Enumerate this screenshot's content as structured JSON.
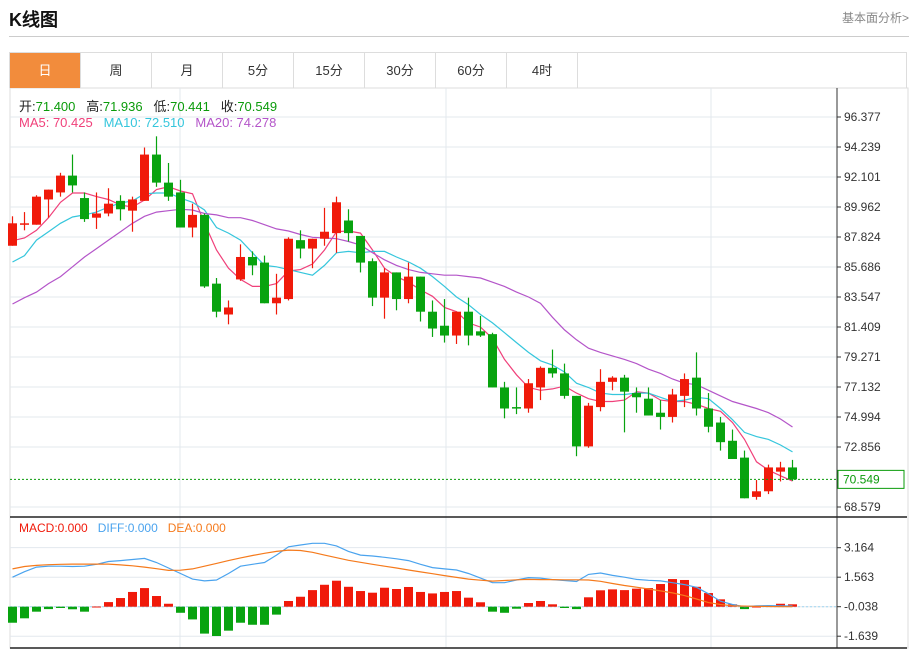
{
  "header": {
    "title": "K线图",
    "link": "基本面分析>"
  },
  "tabs": [
    "日",
    "周",
    "月",
    "5分",
    "15分",
    "30分",
    "60分",
    "4时"
  ],
  "ohlc": {
    "open_label": "开:",
    "open": "71.400",
    "high_label": "高:",
    "high": "71.936",
    "low_label": "低:",
    "low": "70.441",
    "close_label": "收:",
    "close": "70.549"
  },
  "ma_legend": {
    "ma5": "MA5: 70.425",
    "ma10": "MA10: 72.510",
    "ma20": "MA20: 74.278"
  },
  "macd_legend": {
    "macd": "MACD:0.000",
    "diff": "DIFF:0.000",
    "dea": "DEA:0.000"
  },
  "colors": {
    "up": "#f01a0a",
    "down": "#08a30f",
    "ma5": "#f0407a",
    "ma10": "#35c6dc",
    "ma20": "#b455c9",
    "diff": "#4aa3ee",
    "dea": "#f57a1c",
    "accent": "#f28c3c"
  },
  "chart_data": [
    {
      "type": "candlestick",
      "price_ticks": [
        "96.377",
        "94.239",
        "92.101",
        "89.962",
        "87.824",
        "85.686",
        "83.547",
        "81.409",
        "79.271",
        "77.132",
        "74.994",
        "72.856",
        "68.579"
      ],
      "price_tick_values": [
        96.377,
        94.239,
        92.101,
        89.962,
        87.824,
        85.686,
        83.547,
        81.409,
        79.271,
        77.132,
        74.994,
        72.856,
        68.579
      ],
      "last_price": "70.549",
      "last_price_value": 70.549,
      "candles_ohlc": [
        [
          87.2,
          89.3,
          87.2,
          88.8
        ],
        [
          88.7,
          89.6,
          88.3,
          88.8
        ],
        [
          88.7,
          90.8,
          88.7,
          90.7
        ],
        [
          90.5,
          91.2,
          89.2,
          91.2
        ],
        [
          91.0,
          92.4,
          90.7,
          92.2
        ],
        [
          92.2,
          93.7,
          91.0,
          91.5
        ],
        [
          90.6,
          91.0,
          88.9,
          89.1
        ],
        [
          89.2,
          91.0,
          88.4,
          89.5
        ],
        [
          89.5,
          91.3,
          89.3,
          90.2
        ],
        [
          90.4,
          90.8,
          89.0,
          89.8
        ],
        [
          89.7,
          90.7,
          88.2,
          90.5
        ],
        [
          90.4,
          94.2,
          90.4,
          93.7
        ],
        [
          93.7,
          95.0,
          91.4,
          91.7
        ],
        [
          91.7,
          93.1,
          90.4,
          90.7
        ],
        [
          91.0,
          91.9,
          88.5,
          88.5
        ],
        [
          88.5,
          90.2,
          87.8,
          89.4
        ],
        [
          89.4,
          89.5,
          84.2,
          84.3
        ],
        [
          84.5,
          84.9,
          82.1,
          82.5
        ],
        [
          82.3,
          83.3,
          81.6,
          82.8
        ],
        [
          84.8,
          87.3,
          84.7,
          86.4
        ],
        [
          86.4,
          86.8,
          85.1,
          85.8
        ],
        [
          86.0,
          86.5,
          83.1,
          83.1
        ],
        [
          83.1,
          85.2,
          82.3,
          83.5
        ],
        [
          83.4,
          87.8,
          83.3,
          87.7
        ],
        [
          87.6,
          88.3,
          86.3,
          87.0
        ],
        [
          87.0,
          87.7,
          85.6,
          87.7
        ],
        [
          87.7,
          89.9,
          87.2,
          88.2
        ],
        [
          88.1,
          90.7,
          86.7,
          90.3
        ],
        [
          89.0,
          89.8,
          87.5,
          88.1
        ],
        [
          87.9,
          87.9,
          85.3,
          86.0
        ],
        [
          86.1,
          86.3,
          82.9,
          83.5
        ],
        [
          83.5,
          85.6,
          82.0,
          85.3
        ],
        [
          85.3,
          85.3,
          82.6,
          83.4
        ],
        [
          83.4,
          86.0,
          83.1,
          85.0
        ],
        [
          85.0,
          85.0,
          81.8,
          82.5
        ],
        [
          82.5,
          83.3,
          80.7,
          81.3
        ],
        [
          81.5,
          83.4,
          80.3,
          80.8
        ],
        [
          80.8,
          82.5,
          80.2,
          82.5
        ],
        [
          82.5,
          83.5,
          80.1,
          80.8
        ],
        [
          81.1,
          82.2,
          80.7,
          80.8
        ],
        [
          80.9,
          81.0,
          77.1,
          77.1
        ],
        [
          77.1,
          77.5,
          74.9,
          75.6
        ],
        [
          75.7,
          77.1,
          75.2,
          75.6
        ],
        [
          75.6,
          77.7,
          75.3,
          77.4
        ],
        [
          77.1,
          78.6,
          76.2,
          78.5
        ],
        [
          78.5,
          79.8,
          77.8,
          78.1
        ],
        [
          78.1,
          78.8,
          76.3,
          76.5
        ],
        [
          76.5,
          76.5,
          72.2,
          72.9
        ],
        [
          72.9,
          76.0,
          72.8,
          75.8
        ],
        [
          75.7,
          78.4,
          75.4,
          77.5
        ],
        [
          77.5,
          77.9,
          76.9,
          77.8
        ],
        [
          77.8,
          78.0,
          73.9,
          76.8
        ],
        [
          76.7,
          77.1,
          75.3,
          76.4
        ],
        [
          76.3,
          77.1,
          75.1,
          75.1
        ],
        [
          75.3,
          76.2,
          74.1,
          75.0
        ],
        [
          75.0,
          77.0,
          74.6,
          76.6
        ],
        [
          76.5,
          78.1,
          75.7,
          77.7
        ],
        [
          77.8,
          79.6,
          75.1,
          75.6
        ],
        [
          75.6,
          76.7,
          73.9,
          74.3
        ],
        [
          74.6,
          75.0,
          72.6,
          73.2
        ],
        [
          73.3,
          74.1,
          72.0,
          72.0
        ],
        [
          72.1,
          72.6,
          69.2,
          69.2
        ],
        [
          69.3,
          70.5,
          69.1,
          69.7
        ],
        [
          69.7,
          71.6,
          69.5,
          71.4
        ],
        [
          71.1,
          71.8,
          70.4,
          71.4
        ],
        [
          71.4,
          71.936,
          70.441,
          70.549
        ]
      ],
      "ma5": [
        87.56,
        87.75,
        88.3,
        89.2,
        90.3,
        90.96,
        90.96,
        90.7,
        90.5,
        90.1,
        89.96,
        90.46,
        91.2,
        91.4,
        91.1,
        90.9,
        88.8,
        86.9,
        85.6,
        84.8,
        84.3,
        84.3,
        84.5,
        85.4,
        85.5,
        85.9,
        86.9,
        88.2,
        88.25,
        88.1,
        86.9,
        85.6,
        85.0,
        84.6,
        84.05,
        83.6,
        82.8,
        82.5,
        81.7,
        81.4,
        80.6,
        79.1,
        78.0,
        77.1,
        76.9,
        77.0,
        77.2,
        76.7,
        76.3,
        76.1,
        76.1,
        76.2,
        76.8,
        76.7,
        76.2,
        76.1,
        76.1,
        75.9,
        75.6,
        75.4,
        74.6,
        73.4,
        71.8,
        71.2,
        70.8,
        70.425
      ],
      "ma10": [
        86.04,
        86.5,
        87.6,
        88.2,
        88.8,
        89.25,
        89.4,
        89.6,
        89.96,
        90.25,
        90.4,
        90.9,
        90.96,
        90.96,
        90.6,
        90.3,
        89.75,
        88.5,
        88.1,
        87.6,
        86.7,
        85.8,
        85.7,
        85.5,
        85.3,
        85.1,
        85.8,
        86.7,
        86.8,
        86.7,
        86.8,
        86.8,
        86.4,
        86.05,
        85.6,
        85.0,
        84.3,
        83.55,
        83.0,
        82.3,
        81.7,
        81.0,
        80.3,
        79.6,
        79.0,
        78.7,
        78.2,
        77.4,
        77.1,
        76.7,
        76.6,
        76.6,
        76.7,
        76.7,
        76.4,
        76.1,
        76.2,
        76.4,
        76.3,
        75.6,
        74.8,
        73.9,
        73.6,
        73.4,
        73.0,
        72.51
      ],
      "ma20": [
        83.05,
        83.5,
        83.9,
        84.5,
        85.0,
        85.7,
        86.4,
        87.0,
        87.6,
        88.2,
        88.8,
        89.3,
        89.6,
        89.7,
        89.8,
        89.75,
        89.5,
        89.4,
        89.2,
        89.2,
        89.0,
        88.7,
        88.4,
        88.25,
        88.0,
        87.8,
        87.75,
        87.7,
        87.5,
        87.25,
        86.7,
        86.2,
        85.8,
        85.5,
        85.3,
        85.2,
        85.1,
        85.1,
        85.0,
        84.9,
        84.6,
        84.3,
        83.9,
        83.55,
        83.1,
        82.1,
        81.2,
        80.5,
        79.9,
        79.6,
        79.35,
        79.1,
        78.8,
        78.4,
        78.1,
        77.7,
        77.4,
        77.3,
        76.9,
        76.5,
        76.1,
        75.85,
        75.6,
        75.3,
        74.85,
        74.278
      ]
    },
    {
      "type": "macd",
      "ticks": [
        "3.164",
        "1.563",
        "-0.038",
        "-1.639"
      ],
      "tick_values": [
        3.164,
        1.563,
        -0.038,
        -1.639
      ],
      "histogram": [
        -0.87,
        -0.63,
        -0.27,
        -0.13,
        -0.07,
        -0.14,
        -0.27,
        0.01,
        0.25,
        0.47,
        0.8,
        1.01,
        0.58,
        0.16,
        -0.33,
        -0.69,
        -1.46,
        -1.59,
        -1.3,
        -0.87,
        -0.98,
        -0.98,
        -0.43,
        0.31,
        0.54,
        0.9,
        1.19,
        1.41,
        1.08,
        0.85,
        0.76,
        1.03,
        0.96,
        1.07,
        0.8,
        0.72,
        0.8,
        0.85,
        0.49,
        0.24,
        -0.27,
        -0.33,
        -0.11,
        0.2,
        0.31,
        0.13,
        -0.07,
        -0.13,
        0.51,
        0.89,
        0.94,
        0.9,
        0.98,
        1.01,
        1.23,
        1.5,
        1.45,
        1.08,
        0.74,
        0.4,
        0.13,
        -0.13,
        0.01,
        0.05,
        0.16,
        0.13
      ],
      "diff": [
        1.6,
        1.9,
        2.15,
        2.2,
        2.2,
        2.18,
        2.2,
        2.3,
        2.45,
        2.5,
        2.56,
        2.62,
        2.4,
        2.1,
        1.8,
        1.5,
        1.4,
        1.45,
        1.8,
        2.2,
        2.3,
        2.4,
        2.8,
        3.25,
        3.35,
        3.44,
        3.44,
        3.3,
        3.0,
        2.8,
        2.75,
        2.68,
        2.6,
        2.5,
        2.3,
        2.12,
        2.05,
        1.99,
        1.8,
        1.55,
        1.3,
        1.3,
        1.45,
        1.58,
        1.55,
        1.47,
        1.42,
        1.37,
        1.75,
        1.83,
        1.7,
        1.6,
        1.48,
        1.43,
        1.4,
        1.3,
        1.2,
        1.05,
        0.7,
        0.3,
        0.12,
        0,
        0.05,
        0.06,
        0.05,
        0.04
      ],
      "dea": [
        2.05,
        2.18,
        2.24,
        2.28,
        2.3,
        2.31,
        2.31,
        2.31,
        2.31,
        2.27,
        2.22,
        2.15,
        2.06,
        1.97,
        1.98,
        2.05,
        2.2,
        2.35,
        2.5,
        2.65,
        2.78,
        2.9,
        3.0,
        3.07,
        3.05,
        2.95,
        2.8,
        2.66,
        2.52,
        2.41,
        2.3,
        2.2,
        2.1,
        1.99,
        1.89,
        1.79,
        1.69,
        1.59,
        1.5,
        1.44,
        1.39,
        1.42,
        1.46,
        1.48,
        1.47,
        1.47,
        1.46,
        1.46,
        1.45,
        1.38,
        1.26,
        1.15,
        1.06,
        0.96,
        0.86,
        0.75,
        0.6,
        0.42,
        0.22,
        0.12,
        0.05,
        0.03,
        0.02,
        0.01,
        0,
        0
      ]
    }
  ]
}
